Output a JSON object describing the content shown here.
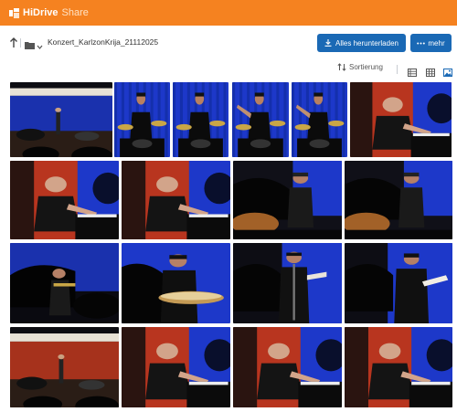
{
  "app": {
    "brand": "HiDrive",
    "sub": "Share",
    "brand_color": "#f58220",
    "button_color": "#1a69b5"
  },
  "toolbar": {
    "breadcrumb": "Konzert_KarlzonKrija_21112025",
    "download_label": "Alles herunterladen",
    "more_label": "mehr"
  },
  "sort": {
    "label": "Sortierung"
  },
  "icons": {
    "up": "arrow-up-icon",
    "folder": "folder-icon",
    "chevron": "chevron-down-icon",
    "download": "download-icon",
    "more": "more-dots-icon",
    "sort": "sort-icon",
    "list": "list-view-icon",
    "grid": "grid-view-icon",
    "gallery": "gallery-view-icon"
  },
  "photos": [
    {
      "scene": "stage-wide"
    },
    {
      "scene": "drummer"
    },
    {
      "scene": "drummer"
    },
    {
      "scene": "drummer-arm"
    },
    {
      "scene": "drummer-arm"
    },
    {
      "scene": "pianist"
    },
    {
      "scene": "pianist-red"
    },
    {
      "scene": "pianist-red"
    },
    {
      "scene": "singer-piano"
    },
    {
      "scene": "singer-piano"
    },
    {
      "scene": "piano-silhouette"
    },
    {
      "scene": "performer-drum"
    },
    {
      "scene": "singer-mic"
    },
    {
      "scene": "performer-paper"
    },
    {
      "scene": "stage-wide-red"
    },
    {
      "scene": "pianist-red"
    },
    {
      "scene": "pianist-red"
    },
    {
      "scene": "pianist-red"
    }
  ]
}
